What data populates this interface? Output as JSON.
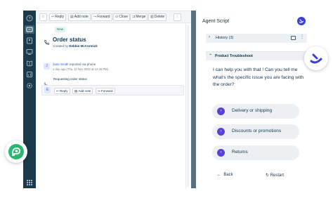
{
  "toolbar": {
    "reply": "Reply",
    "add_note": "Add note",
    "forward": "Forward",
    "close": "Close",
    "merge": "Merge",
    "delete": "Delete"
  },
  "ticket": {
    "badge": "New",
    "subject": "Order status",
    "created_by_prefix": "Created by",
    "created_by_name": "Debbie McCormick",
    "conversation": {
      "avatar_initial": "J",
      "author": "Jane Smith",
      "action": "reported via phone",
      "timestamp": "1 day ago (Thu, 11 Nov 2022 at 12:28 PM)",
      "message": "Requesting order status"
    },
    "reply_bar": {
      "avatar_initial": "E",
      "reply": "Reply",
      "add_note": "Add note",
      "forward": "Forward"
    }
  },
  "agent_script": {
    "title": "Agent Script",
    "history_label": "History (3)",
    "section_label": "Product Troubleshoot",
    "question": "I can help you with that ! Can you tell me what's the specific issue you are facing with the order?",
    "options": [
      {
        "label": "Delivery or shipping"
      },
      {
        "label": "Discounts or promotions"
      },
      {
        "label": "Returns"
      }
    ],
    "back_label": "Back",
    "restart_label": "Restart"
  },
  "colors": {
    "nav_bg": "#1b3a4b",
    "accent_purple": "#5b3fd9",
    "brand_green": "#2bb673",
    "brand_blue": "#3b3fd8"
  }
}
